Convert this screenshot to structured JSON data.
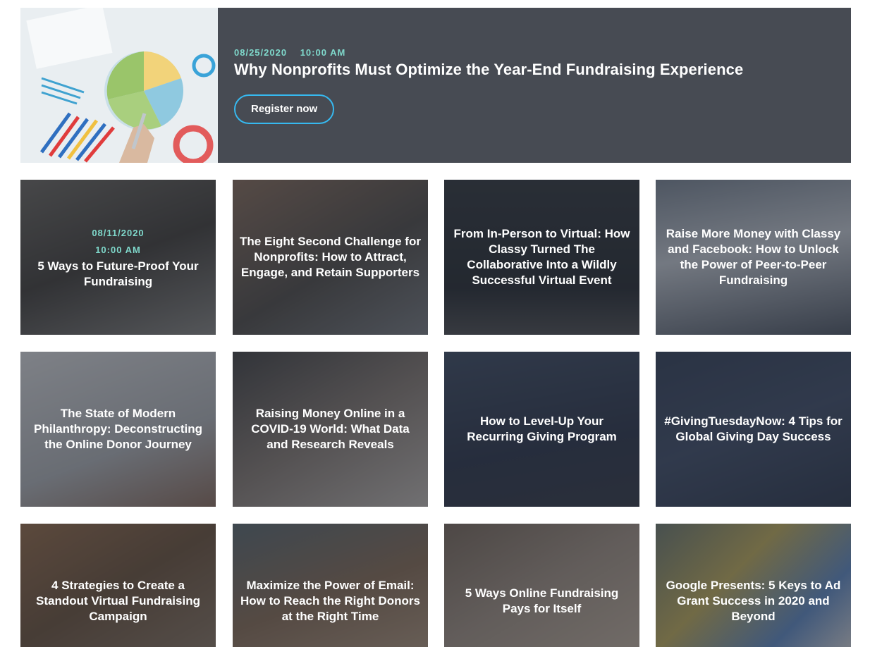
{
  "featured": {
    "date": "08/25/2020",
    "time": "10:00 AM",
    "title": "Why Nonprofits Must Optimize the Year-End Fundraising Experience",
    "button_label": "Register now"
  },
  "cards": [
    {
      "date": "08/11/2020",
      "time": "10:00 AM",
      "title": "5 Ways to Future-Proof Your Fundraising"
    },
    {
      "title": "The Eight Second Challenge for Nonprofits: How to Attract, Engage, and Retain Supporters"
    },
    {
      "title": "From In-Person to Virtual: How Classy Turned The Collaborative Into a Wildly Successful Virtual Event"
    },
    {
      "title": "Raise More Money with Classy and Facebook: How to Unlock the Power of Peer-to-Peer Fundraising"
    },
    {
      "title": "The State of Modern Philanthropy: Deconstructing the Online Donor Journey"
    },
    {
      "title": "Raising Money Online in a COVID-19 World: What Data and Research Reveals"
    },
    {
      "title": "How to Level-Up Your Recurring Giving Program"
    },
    {
      "title": "#GivingTuesdayNow: 4 Tips for Global Giving Day Success"
    },
    {
      "title": "4 Strategies to Create a Standout Virtual Fundraising Campaign"
    },
    {
      "title": "Maximize the Power of Email: How to Reach the Right Donors at the Right Time"
    },
    {
      "title": "5 Ways Online Fundraising Pays for Itself"
    },
    {
      "title": "Google Presents: 5 Keys to Ad Grant Success in 2020 and Beyond"
    }
  ],
  "colors": {
    "banner_bg": "#474b53",
    "meta_teal": "#7fd8cb",
    "button_border": "#36b9f0"
  }
}
